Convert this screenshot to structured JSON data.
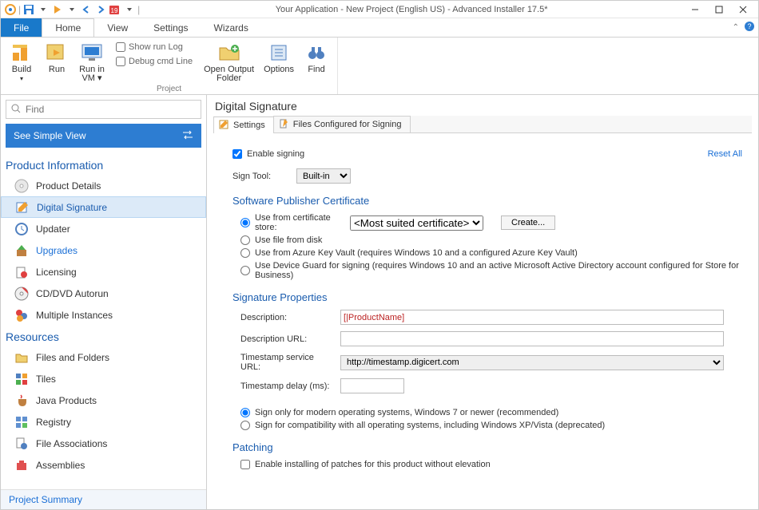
{
  "window": {
    "title": "Your Application - New Project (English US) - Advanced Installer 17.5*"
  },
  "tabs": {
    "file": "File",
    "home": "Home",
    "view": "View",
    "settings": "Settings",
    "wizards": "Wizards"
  },
  "ribbon": {
    "build": "Build",
    "run": "Run",
    "run_in_vm": "Run in\nVM ▾",
    "show_run_log": "Show run Log",
    "debug_cmd": "Debug cmd Line",
    "open_output": "Open Output\nFolder",
    "options": "Options",
    "find": "Find",
    "group_project": "Project"
  },
  "sidebar": {
    "search_placeholder": "Find",
    "simple_view": "See Simple View",
    "section_product": "Product Information",
    "section_resources": "Resources",
    "items_product": [
      {
        "label": "Product Details"
      },
      {
        "label": "Digital Signature"
      },
      {
        "label": "Updater"
      },
      {
        "label": "Upgrades"
      },
      {
        "label": "Licensing"
      },
      {
        "label": "CD/DVD Autorun"
      },
      {
        "label": "Multiple Instances"
      }
    ],
    "items_resources": [
      {
        "label": "Files and Folders"
      },
      {
        "label": "Tiles"
      },
      {
        "label": "Java Products"
      },
      {
        "label": "Registry"
      },
      {
        "label": "File Associations"
      },
      {
        "label": "Assemblies"
      }
    ],
    "footer": "Project Summary"
  },
  "content": {
    "title": "Digital Signature",
    "tab_settings": "Settings",
    "tab_files": "Files Configured for Signing",
    "enable_signing": "Enable signing",
    "reset_all": "Reset All",
    "sign_tool_label": "Sign Tool:",
    "sign_tool_value": "Built-in",
    "sec_cert": "Software Publisher Certificate",
    "opt_store": "Use from certificate store:",
    "store_value": "<Most suited certificate>",
    "create_btn": "Create...",
    "opt_disk": "Use file from disk",
    "opt_azure": "Use from Azure Key Vault (requires Windows 10 and a configured Azure Key Vault)",
    "opt_device_guard": "Use Device Guard for signing (requires Windows 10 and an active Microsoft Active Directory account configured for Store for Business)",
    "sec_sig": "Signature Properties",
    "desc_label": "Description:",
    "desc_value": "[|ProductName]",
    "desc_url_label": "Description URL:",
    "ts_url_label": "Timestamp service URL:",
    "ts_url_value": "http://timestamp.digicert.com",
    "ts_delay_label": "Timestamp delay (ms):",
    "opt_modern": "Sign only for modern operating systems, Windows 7 or newer (recommended)",
    "opt_compat": "Sign for compatibility with all operating systems, including Windows XP/Vista (deprecated)",
    "sec_patch": "Patching",
    "patch_check": "Enable installing of patches for this product without elevation"
  }
}
